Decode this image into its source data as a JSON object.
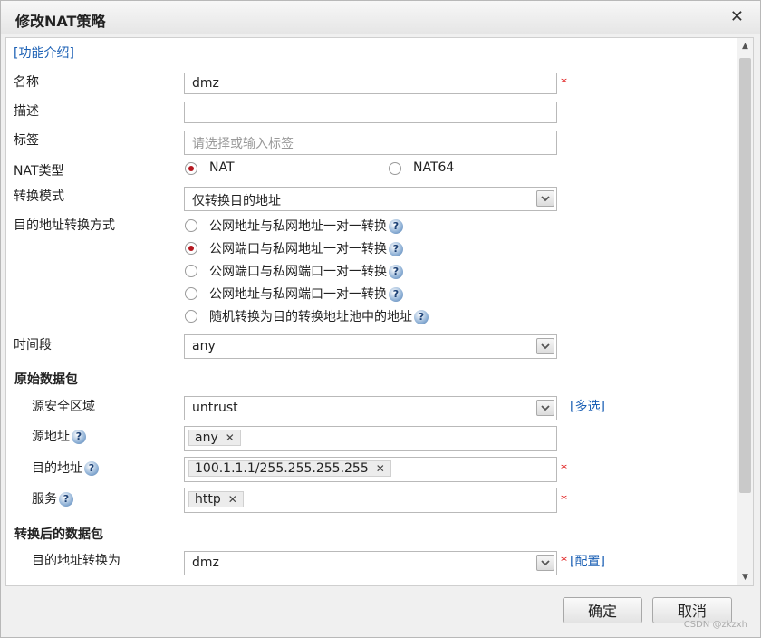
{
  "dialog": {
    "title": "修改NAT策略",
    "close_icon": "✕",
    "intro_link": "[功能介绍]"
  },
  "form": {
    "name_label": "名称",
    "name_value": "dmz",
    "desc_label": "描述",
    "desc_value": "",
    "tag_label": "标签",
    "tag_placeholder": "请选择或输入标签",
    "nat_type_label": "NAT类型",
    "nat_type_options": [
      {
        "label": "NAT",
        "selected": true
      },
      {
        "label": "NAT64",
        "selected": false
      }
    ],
    "mode_label": "转换模式",
    "mode_value": "仅转换目的地址",
    "dst_method_label": "目的地址转换方式",
    "dst_methods": [
      {
        "label": "公网地址与私网地址一对一转换",
        "selected": false
      },
      {
        "label": "公网端口与私网地址一对一转换",
        "selected": true
      },
      {
        "label": "公网端口与私网端口一对一转换",
        "selected": false
      },
      {
        "label": "公网地址与私网端口一对一转换",
        "selected": false
      },
      {
        "label": "随机转换为目的转换地址池中的地址",
        "selected": false
      }
    ],
    "time_label": "时间段",
    "time_value": "any",
    "required_mark": "*",
    "help_glyph": "?"
  },
  "original_packet": {
    "section_title": "原始数据包",
    "src_zone_label": "源安全区域",
    "src_zone_value": "untrust",
    "multi_select_link": "[多选]",
    "src_addr_label": "源地址",
    "src_addr_tags": [
      "any"
    ],
    "dst_addr_label": "目的地址",
    "dst_addr_tags": [
      "100.1.1.1/255.255.255.255"
    ],
    "service_label": "服务",
    "service_tags": [
      "http"
    ]
  },
  "translated_packet": {
    "section_title": "转换后的数据包",
    "dst_translate_label": "目的地址转换为",
    "dst_translate_value": "dmz",
    "config_link": "[配置]"
  },
  "footer": {
    "ok_label": "确定",
    "cancel_label": "取消",
    "watermark": "CSDN @zkzxh"
  },
  "colors": {
    "link": "#1a5fb4",
    "required": "#dd0000",
    "radio_selected": "#b5171f"
  }
}
